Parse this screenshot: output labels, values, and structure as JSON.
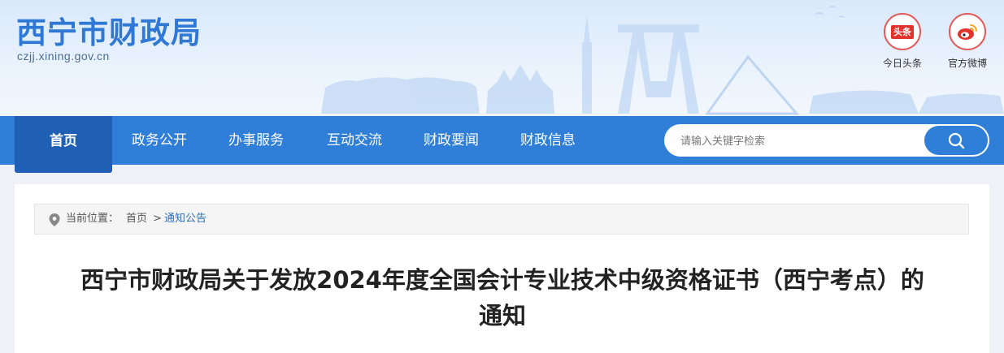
{
  "header": {
    "site_title": "西宁市财政局",
    "site_domain": "czjj.xining.gov.cn",
    "social": [
      {
        "label": "今日头条",
        "icon": "toutiao-icon",
        "icon_text": "头条"
      },
      {
        "label": "官方微博",
        "icon": "weibo-icon"
      }
    ]
  },
  "nav": {
    "home": "首页",
    "items": [
      "政务公开",
      "办事服务",
      "互动交流",
      "财政要闻",
      "财政信息"
    ],
    "search_placeholder": "请输入关键字检索",
    "search_icon": "search-icon"
  },
  "breadcrumb": {
    "prefix": "当前位置：",
    "home": "首页",
    "separator": ">",
    "current": "通知公告"
  },
  "article": {
    "title": "西宁市财政局关于发放2024年度全国会计专业技术中级资格证书（西宁考点）的通知"
  },
  "colors": {
    "brand_blue": "#2f7fd9",
    "home_tab": "#1f5fb4",
    "title_blue": "#2f78d6",
    "social_red": "#e25a5a"
  }
}
